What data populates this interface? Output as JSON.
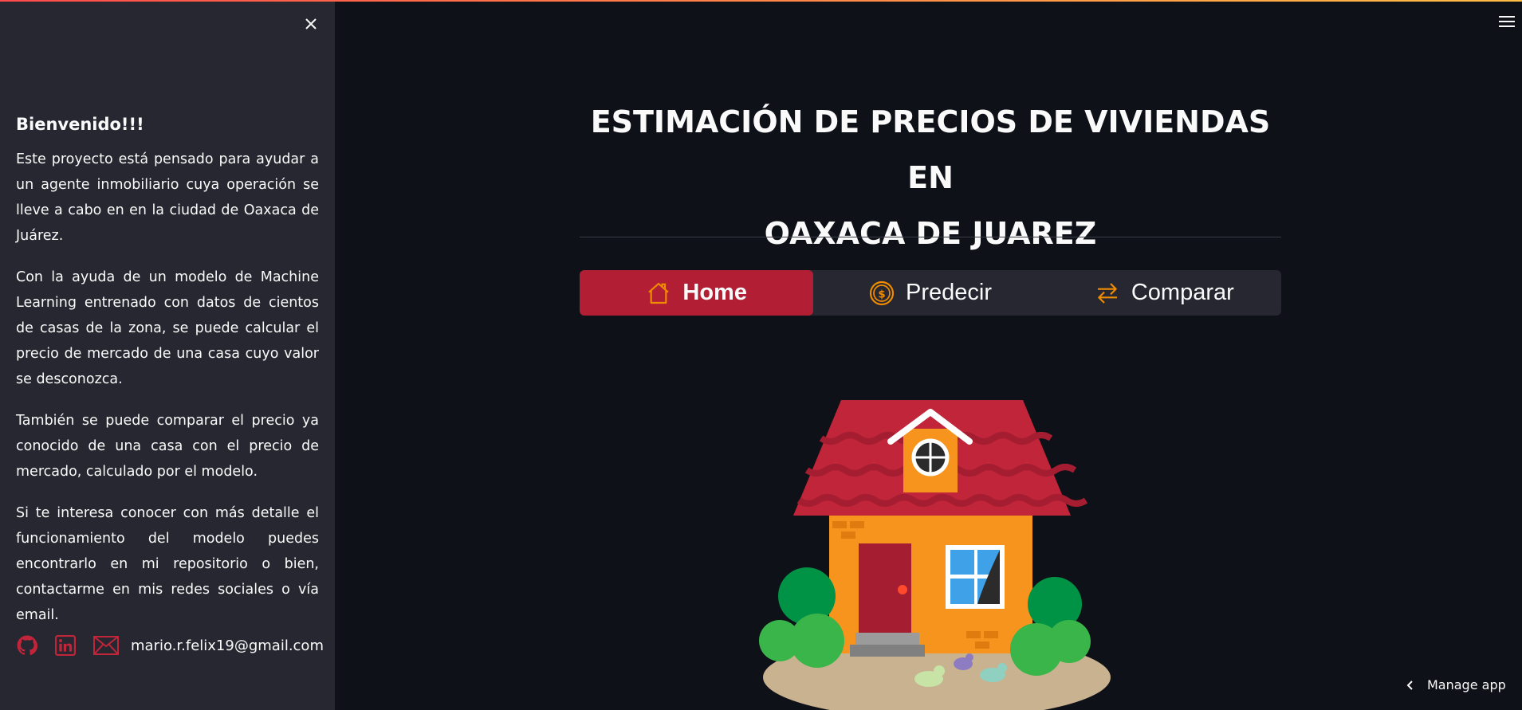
{
  "sidebar": {
    "title": "Bienvenido!!!",
    "paragraphs": [
      "Este proyecto está pensado para ayudar a un agente inmobiliario cuya operación se lleve a cabo en en la ciudad de Oaxaca de Juárez.",
      "Con la ayuda de un modelo de Machine Learning entrenado con datos de cientos de casas de la zona, se puede calcular el precio de mercado de una casa cuyo valor se desconozca.",
      "También se puede comparar el precio ya conocido de una casa con el precio de mercado, calculado por el modelo.",
      "Si te interesa conocer con más detalle el funcionamiento del modelo puedes encontrarlo en mi repositorio o bien, contactarme en mis redes sociales o vía email."
    ],
    "email": "mario.r.felix19@gmail.com",
    "icons": [
      "github-icon",
      "linkedin-icon",
      "mail-icon",
      "close-icon"
    ]
  },
  "main": {
    "title_line1": "ESTIMACIÓN DE PRECIOS DE VIVIENDAS EN",
    "title_line2": "OAXACA DE JUAREZ",
    "nav": [
      {
        "label": "Home",
        "icon": "house-icon",
        "active": true
      },
      {
        "label": "Predecir",
        "icon": "coin-icon",
        "active": false
      },
      {
        "label": "Comparar",
        "icon": "arrows-exchange-icon",
        "active": false
      }
    ]
  },
  "footer": {
    "manage_label": "Manage app"
  },
  "colors": {
    "accent": "#b21f34",
    "nav_icon": "#f08c00",
    "social": "#c1253a",
    "background": "#0e1117",
    "sidebar": "#262730"
  }
}
